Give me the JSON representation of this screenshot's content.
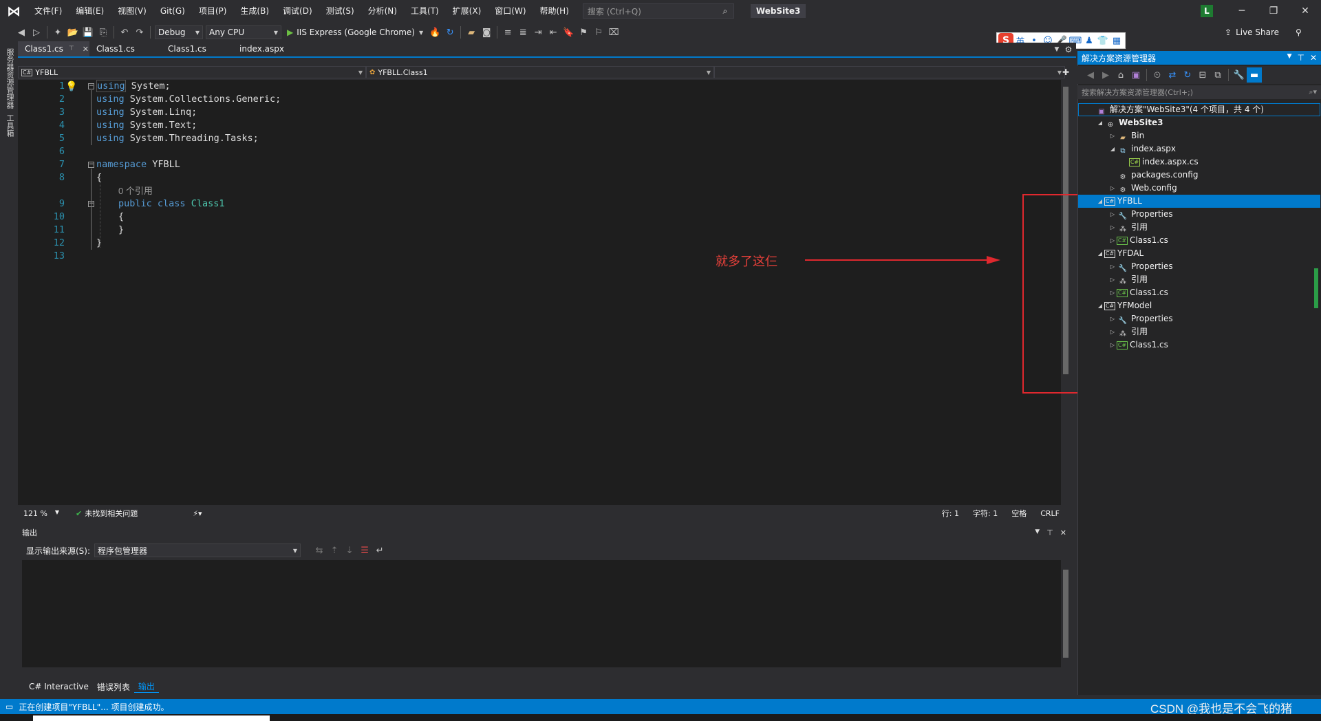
{
  "menu": {
    "items": [
      "文件(F)",
      "编辑(E)",
      "视图(V)",
      "Git(G)",
      "项目(P)",
      "生成(B)",
      "调试(D)",
      "测试(S)",
      "分析(N)",
      "工具(T)",
      "扩展(X)",
      "窗口(W)",
      "帮助(H)"
    ],
    "search_placeholder": "搜索 (Ctrl+Q)",
    "solution_title": "WebSite3",
    "user_initial": "L"
  },
  "toolbar": {
    "config": "Debug",
    "platform": "Any CPU",
    "run_label": "IIS Express (Google Chrome)",
    "live_share": "Live Share",
    "ime_lang": "英"
  },
  "left_strip": {
    "tab1": "服务器资源管理器",
    "tab2": "工具箱"
  },
  "editor_tabs": [
    {
      "label": "Class1.cs",
      "active": true
    },
    {
      "label": "Class1.cs",
      "active": false
    },
    {
      "label": "Class1.cs",
      "active": false
    },
    {
      "label": "index.aspx",
      "active": false
    }
  ],
  "navbar": {
    "project": "YFBLL",
    "type": "YFBLL.Class1",
    "member": ""
  },
  "code": {
    "line_numbers": [
      "1",
      "2",
      "3",
      "4",
      "5",
      "6",
      "7",
      "8",
      "",
      "9",
      "10",
      "11",
      "12",
      "13"
    ],
    "codelens": "0 个引用"
  },
  "annotation": {
    "text": "就多了这仨"
  },
  "editor_status": {
    "zoom": "121 %",
    "issues": "未找到相关问题",
    "line": "行: 1",
    "col": "字符: 1",
    "whitespace": "空格",
    "eol": "CRLF"
  },
  "output": {
    "title": "输出",
    "source_label": "显示输出来源(S):",
    "source_value": "程序包管理器"
  },
  "bottom_tabs": [
    "C# Interactive",
    "错误列表",
    "输出"
  ],
  "solution_explorer": {
    "title": "解决方案资源管理器",
    "search_placeholder": "搜索解决方案资源管理器(Ctrl+;)",
    "tree": [
      {
        "label": "解决方案\"WebSite3\"(4 个项目，共 4 个)",
        "level": 0,
        "kind": "solution",
        "expand": ""
      },
      {
        "label": "WebSite3",
        "level": 1,
        "kind": "web",
        "expand": "open"
      },
      {
        "label": "Bin",
        "level": 2,
        "kind": "folder",
        "expand": "closed"
      },
      {
        "label": "index.aspx",
        "level": 2,
        "kind": "aspx",
        "expand": "open"
      },
      {
        "label": "index.aspx.cs",
        "level": 3,
        "kind": "cs",
        "expand": ""
      },
      {
        "label": "packages.config",
        "level": 2,
        "kind": "config",
        "expand": ""
      },
      {
        "label": "Web.config",
        "level": 2,
        "kind": "config",
        "expand": "closed"
      },
      {
        "label": "YFBLL",
        "level": 1,
        "kind": "csproj",
        "expand": "open",
        "selected": true
      },
      {
        "label": "Properties",
        "level": 2,
        "kind": "wrench",
        "expand": "closed"
      },
      {
        "label": "引用",
        "level": 2,
        "kind": "refs",
        "expand": "closed"
      },
      {
        "label": "Class1.cs",
        "level": 2,
        "kind": "csfile",
        "expand": "closed"
      },
      {
        "label": "YFDAL",
        "level": 1,
        "kind": "csproj",
        "expand": "open"
      },
      {
        "label": "Properties",
        "level": 2,
        "kind": "wrench",
        "expand": "closed"
      },
      {
        "label": "引用",
        "level": 2,
        "kind": "refs",
        "expand": "closed"
      },
      {
        "label": "Class1.cs",
        "level": 2,
        "kind": "csfile",
        "expand": "closed"
      },
      {
        "label": "YFModel",
        "level": 1,
        "kind": "csproj",
        "expand": "open"
      },
      {
        "label": "Properties",
        "level": 2,
        "kind": "wrench",
        "expand": "closed"
      },
      {
        "label": "引用",
        "level": 2,
        "kind": "refs",
        "expand": "closed"
      },
      {
        "label": "Class1.cs",
        "level": 2,
        "kind": "csfile",
        "expand": "closed"
      }
    ]
  },
  "statusbar": {
    "message": "正在创建项目\"YFBLL\"... 项目创建成功。"
  },
  "watermark": "CSDN @我也是不会飞的猪",
  "colors": {
    "accent": "#007acc",
    "annotation": "#e0282e",
    "keyword": "#569cd6",
    "type": "#4ec9b0"
  }
}
